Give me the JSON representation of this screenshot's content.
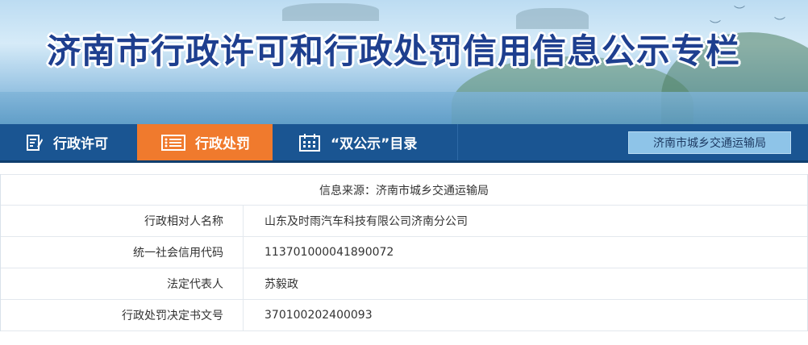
{
  "header": {
    "title": "济南市行政许可和行政处罚信用信息公示专栏"
  },
  "nav": {
    "items": [
      {
        "label": "行政许可",
        "icon": "edit-doc-icon",
        "active": false
      },
      {
        "label": "行政处罚",
        "icon": "list-icon",
        "active": true
      },
      {
        "label": "“双公示”目录",
        "icon": "calendar-icon",
        "active": false
      }
    ],
    "department": "济南市城乡交通运输局"
  },
  "detail": {
    "source": "信息来源：济南市城乡交通运输局",
    "rows": [
      {
        "label": "行政相对人名称",
        "value": "山东及时雨汽车科技有限公司济南分公司"
      },
      {
        "label": "统一社会信用代码",
        "value": "11370100004189007​2"
      },
      {
        "label": "法定代表人",
        "value": "苏毅政"
      },
      {
        "label": "行政处罚决定书文号",
        "value": "370100202400093"
      }
    ]
  },
  "colors": {
    "nav_bg": "#1a5592",
    "nav_active": "#f07a2d",
    "title_color": "#1e3f8f",
    "department_bg": "#8ec4e8"
  }
}
